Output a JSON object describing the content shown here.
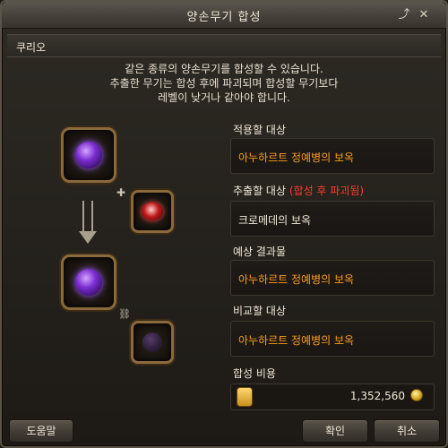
{
  "window": {
    "title": "양손무기 합성"
  },
  "section": {
    "name": "쿠리오"
  },
  "description": {
    "line1": "같은 종류의 양손무기를 합성할 수 있습니다.",
    "line2": "추출한 무기는 합성 후에 파괴되며 합성할 무기보다",
    "line3": "레벨이 낮거나 같아야 합니다."
  },
  "target": {
    "label": "적용할 대상",
    "value": "아누하르트 정예병의 보옥"
  },
  "extract": {
    "label": "추출할 대상",
    "warning": "(합성 후 파괴됨)",
    "value": "크로메데의 보옥"
  },
  "result": {
    "label": "예상 결과물",
    "value": "아누하르트 정예병의 보옥"
  },
  "compare": {
    "label": "비교할 대상",
    "value": "아누하르트 정예병의 보옥"
  },
  "cost": {
    "label": "합성 비용",
    "value": "1,352,560"
  },
  "buttons": {
    "help": "도움말",
    "ok": "확인",
    "cancel": "취소"
  },
  "icons": {
    "minimize": "restore-icon",
    "close": "close-icon",
    "plus": "plus-icon",
    "arrow": "arrow-down-icon",
    "link": "link-icon",
    "kinah": "kinah-coin-icon"
  },
  "colors": {
    "item_name": "#ff9c1a",
    "warning": "#ff3b2f"
  }
}
